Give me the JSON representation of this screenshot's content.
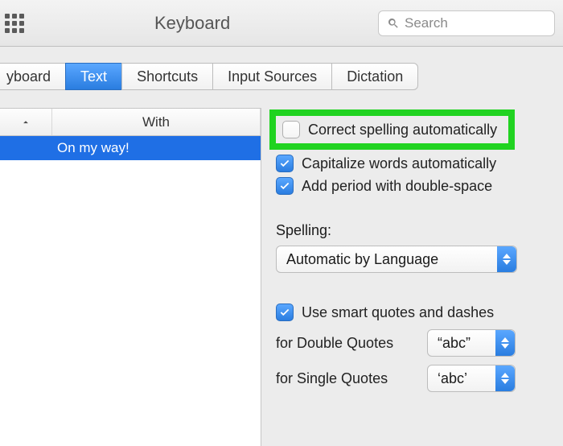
{
  "toolbar": {
    "title": "Keyboard",
    "search_placeholder": "Search"
  },
  "tabs": [
    {
      "label": "yboard",
      "selected": false
    },
    {
      "label": "Text",
      "selected": true
    },
    {
      "label": "Shortcuts",
      "selected": false
    },
    {
      "label": "Input Sources",
      "selected": false
    },
    {
      "label": "Dictation",
      "selected": false
    }
  ],
  "table": {
    "column_with": "With",
    "rows": [
      {
        "replace": "",
        "with": "On my way!",
        "selected": true
      }
    ]
  },
  "options": {
    "correct_spelling": {
      "label": "Correct spelling automatically",
      "checked": false
    },
    "capitalize_words": {
      "label": "Capitalize words automatically",
      "checked": true
    },
    "add_period": {
      "label": "Add period with double-space",
      "checked": true
    },
    "spelling_label": "Spelling:",
    "spelling_value": "Automatic by Language",
    "smart_quotes": {
      "label": "Use smart quotes and dashes",
      "checked": true
    },
    "double_quotes_label": "for Double Quotes",
    "double_quotes_value": "“abc”",
    "single_quotes_label": "for Single Quotes",
    "single_quotes_value": "‘abc’"
  }
}
